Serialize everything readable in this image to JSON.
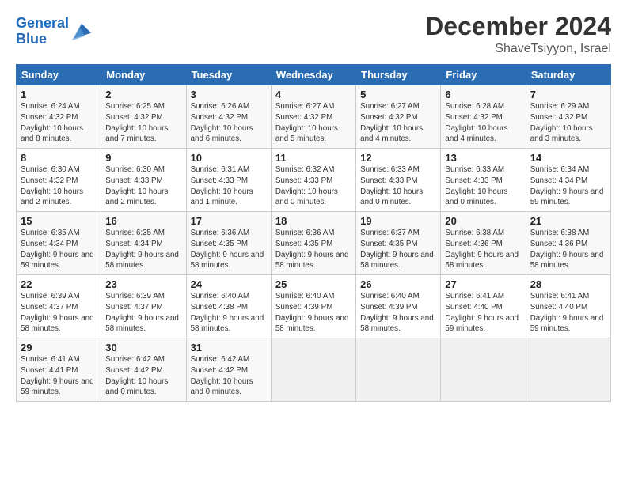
{
  "header": {
    "logo_line1": "General",
    "logo_line2": "Blue",
    "month": "December 2024",
    "location": "ShaveTsiyyon, Israel"
  },
  "weekdays": [
    "Sunday",
    "Monday",
    "Tuesday",
    "Wednesday",
    "Thursday",
    "Friday",
    "Saturday"
  ],
  "weeks": [
    [
      {
        "day": "1",
        "sunrise": "6:24 AM",
        "sunset": "4:32 PM",
        "daylight": "10 hours and 8 minutes."
      },
      {
        "day": "2",
        "sunrise": "6:25 AM",
        "sunset": "4:32 PM",
        "daylight": "10 hours and 7 minutes."
      },
      {
        "day": "3",
        "sunrise": "6:26 AM",
        "sunset": "4:32 PM",
        "daylight": "10 hours and 6 minutes."
      },
      {
        "day": "4",
        "sunrise": "6:27 AM",
        "sunset": "4:32 PM",
        "daylight": "10 hours and 5 minutes."
      },
      {
        "day": "5",
        "sunrise": "6:27 AM",
        "sunset": "4:32 PM",
        "daylight": "10 hours and 4 minutes."
      },
      {
        "day": "6",
        "sunrise": "6:28 AM",
        "sunset": "4:32 PM",
        "daylight": "10 hours and 4 minutes."
      },
      {
        "day": "7",
        "sunrise": "6:29 AM",
        "sunset": "4:32 PM",
        "daylight": "10 hours and 3 minutes."
      }
    ],
    [
      {
        "day": "8",
        "sunrise": "6:30 AM",
        "sunset": "4:32 PM",
        "daylight": "10 hours and 2 minutes."
      },
      {
        "day": "9",
        "sunrise": "6:30 AM",
        "sunset": "4:33 PM",
        "daylight": "10 hours and 2 minutes."
      },
      {
        "day": "10",
        "sunrise": "6:31 AM",
        "sunset": "4:33 PM",
        "daylight": "10 hours and 1 minute."
      },
      {
        "day": "11",
        "sunrise": "6:32 AM",
        "sunset": "4:33 PM",
        "daylight": "10 hours and 0 minutes."
      },
      {
        "day": "12",
        "sunrise": "6:33 AM",
        "sunset": "4:33 PM",
        "daylight": "10 hours and 0 minutes."
      },
      {
        "day": "13",
        "sunrise": "6:33 AM",
        "sunset": "4:33 PM",
        "daylight": "10 hours and 0 minutes."
      },
      {
        "day": "14",
        "sunrise": "6:34 AM",
        "sunset": "4:34 PM",
        "daylight": "9 hours and 59 minutes."
      }
    ],
    [
      {
        "day": "15",
        "sunrise": "6:35 AM",
        "sunset": "4:34 PM",
        "daylight": "9 hours and 59 minutes."
      },
      {
        "day": "16",
        "sunrise": "6:35 AM",
        "sunset": "4:34 PM",
        "daylight": "9 hours and 58 minutes."
      },
      {
        "day": "17",
        "sunrise": "6:36 AM",
        "sunset": "4:35 PM",
        "daylight": "9 hours and 58 minutes."
      },
      {
        "day": "18",
        "sunrise": "6:36 AM",
        "sunset": "4:35 PM",
        "daylight": "9 hours and 58 minutes."
      },
      {
        "day": "19",
        "sunrise": "6:37 AM",
        "sunset": "4:35 PM",
        "daylight": "9 hours and 58 minutes."
      },
      {
        "day": "20",
        "sunrise": "6:38 AM",
        "sunset": "4:36 PM",
        "daylight": "9 hours and 58 minutes."
      },
      {
        "day": "21",
        "sunrise": "6:38 AM",
        "sunset": "4:36 PM",
        "daylight": "9 hours and 58 minutes."
      }
    ],
    [
      {
        "day": "22",
        "sunrise": "6:39 AM",
        "sunset": "4:37 PM",
        "daylight": "9 hours and 58 minutes."
      },
      {
        "day": "23",
        "sunrise": "6:39 AM",
        "sunset": "4:37 PM",
        "daylight": "9 hours and 58 minutes."
      },
      {
        "day": "24",
        "sunrise": "6:40 AM",
        "sunset": "4:38 PM",
        "daylight": "9 hours and 58 minutes."
      },
      {
        "day": "25",
        "sunrise": "6:40 AM",
        "sunset": "4:39 PM",
        "daylight": "9 hours and 58 minutes."
      },
      {
        "day": "26",
        "sunrise": "6:40 AM",
        "sunset": "4:39 PM",
        "daylight": "9 hours and 58 minutes."
      },
      {
        "day": "27",
        "sunrise": "6:41 AM",
        "sunset": "4:40 PM",
        "daylight": "9 hours and 59 minutes."
      },
      {
        "day": "28",
        "sunrise": "6:41 AM",
        "sunset": "4:40 PM",
        "daylight": "9 hours and 59 minutes."
      }
    ],
    [
      {
        "day": "29",
        "sunrise": "6:41 AM",
        "sunset": "4:41 PM",
        "daylight": "9 hours and 59 minutes."
      },
      {
        "day": "30",
        "sunrise": "6:42 AM",
        "sunset": "4:42 PM",
        "daylight": "10 hours and 0 minutes."
      },
      {
        "day": "31",
        "sunrise": "6:42 AM",
        "sunset": "4:42 PM",
        "daylight": "10 hours and 0 minutes."
      },
      null,
      null,
      null,
      null
    ]
  ]
}
